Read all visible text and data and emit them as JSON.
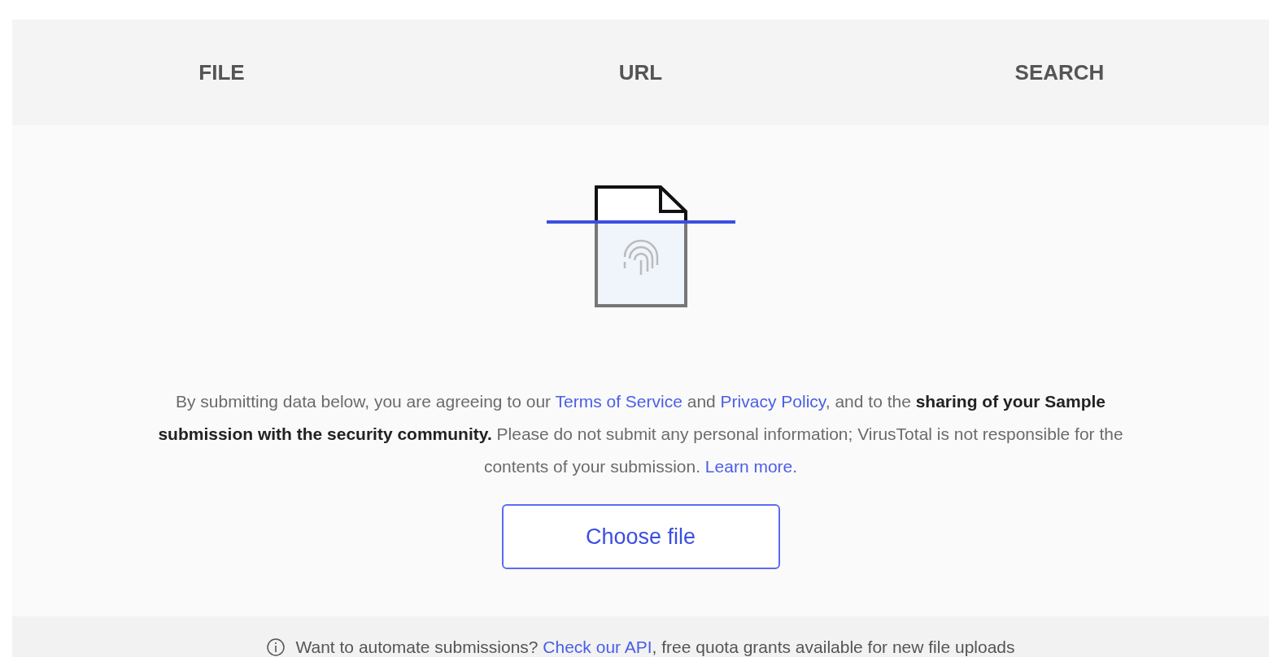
{
  "tabs": [
    {
      "label": "FILE",
      "selected": false
    },
    {
      "label": "URL",
      "selected": false
    },
    {
      "label": "SEARCH",
      "selected": false
    }
  ],
  "notice": [
    {
      "kind": "text",
      "text": "By submitting data below, you are agreeing to our "
    },
    {
      "kind": "link",
      "text": "Terms of Service"
    },
    {
      "kind": "text",
      "text": " and "
    },
    {
      "kind": "link",
      "text": "Privacy Policy"
    },
    {
      "kind": "text",
      "text": ", and to the **sharing of your Sample submission with the security community.** Please do not submit any personal information; VirusTotal is not responsible for the contents of your submission. "
    },
    {
      "kind": "link",
      "text": "Learn more."
    }
  ],
  "choose_button": "Choose file",
  "footer": [
    {
      "kind": "text",
      "text": "Want to automate submissions? "
    },
    {
      "kind": "link",
      "text": "Check our API"
    },
    {
      "kind": "text",
      "text": ", free quota grants available for new file uploads"
    }
  ]
}
